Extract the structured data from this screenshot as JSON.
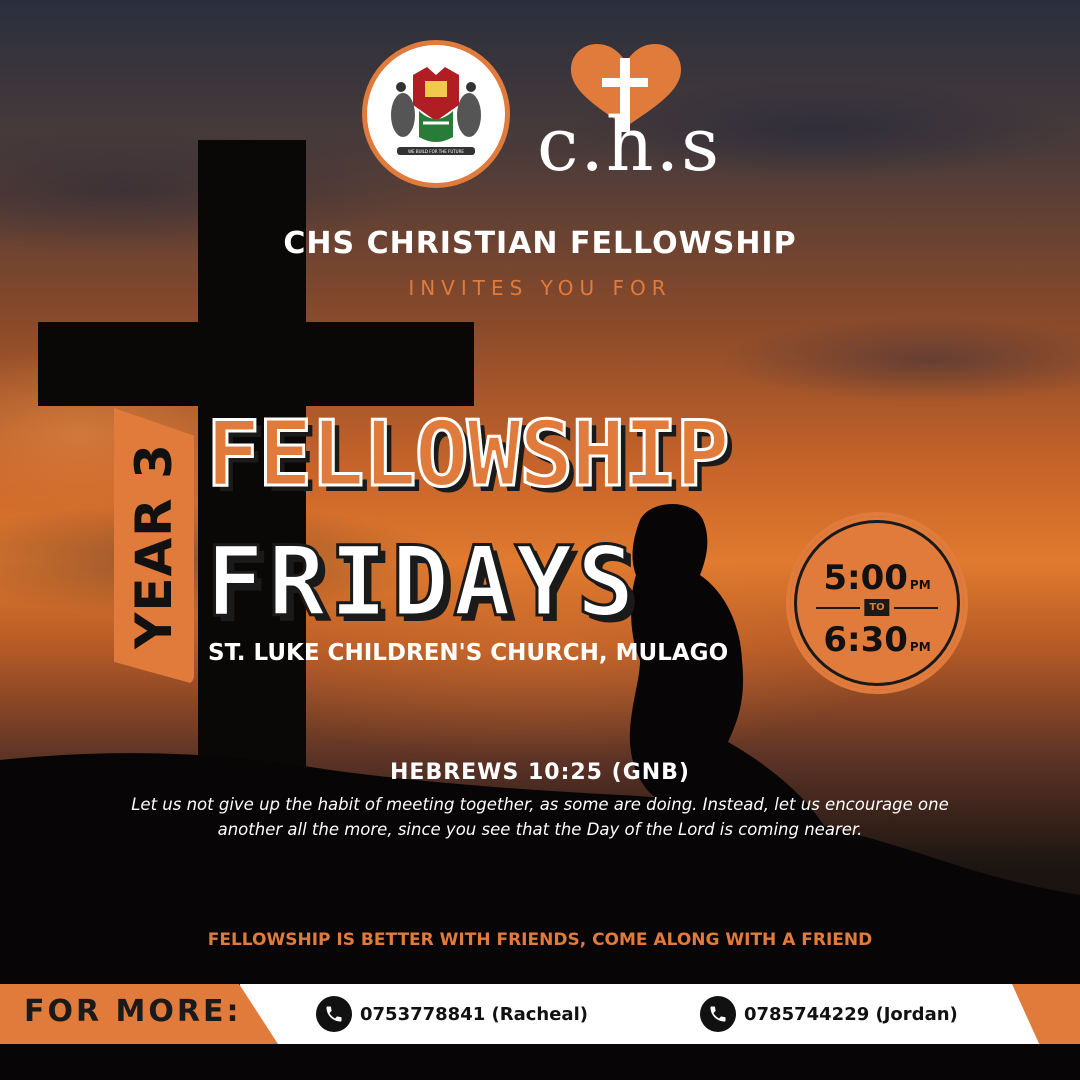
{
  "logos": {
    "chs_wordmark": "c.h.s",
    "crest_motto": "WE BUILD FOR THE FUTURE"
  },
  "header": {
    "title": "CHS CHRISTIAN FELLOWSHIP",
    "subtitle": "INVITES YOU FOR"
  },
  "event": {
    "year_tab": "YEAR 3",
    "line1": "FELLOWSHIP",
    "line2": "FRIDAYS",
    "venue": "ST. LUKE CHILDREN'S CHURCH, MULAGO"
  },
  "time": {
    "start": "5:00",
    "start_suffix": "PM",
    "separator": "TO",
    "end": "6:30",
    "end_suffix": "PM"
  },
  "scripture": {
    "reference": "HEBREWS 10:25 (GNB)",
    "text": "Let us not give up the habit of meeting together, as some are doing. Instead, let us encourage one another all the more, since you see that the Day of the Lord is coming nearer."
  },
  "tagline": "FELLOWSHIP IS BETTER WITH FRIENDS, COME ALONG WITH A FRIEND",
  "footer": {
    "label": "FOR MORE:",
    "contacts": [
      {
        "phone": "0753778841 (Racheal)",
        "icon": "phone-icon"
      },
      {
        "phone": "0785744229 (Jordan)",
        "icon": "phone-icon"
      }
    ]
  },
  "colors": {
    "accent": "#e07b3c",
    "dark": "#111111",
    "white": "#ffffff"
  }
}
